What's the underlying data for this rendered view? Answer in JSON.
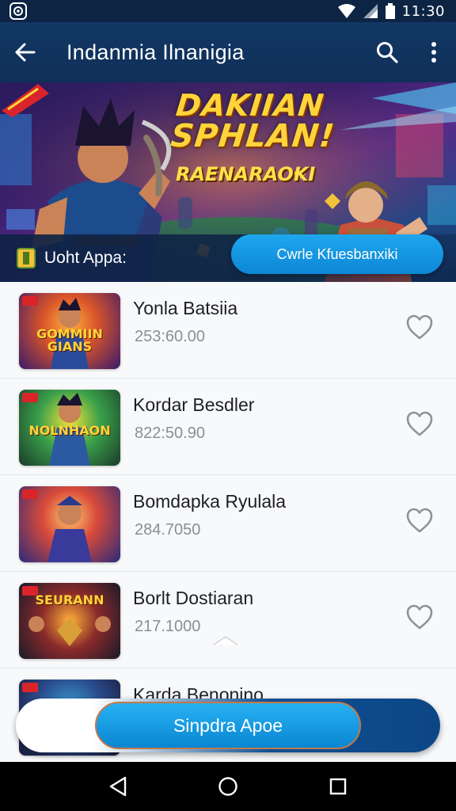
{
  "status_bar": {
    "time": "11:30"
  },
  "app_bar": {
    "title": "Indanmia Ilnanigia"
  },
  "banner": {
    "headline_line1": "DAKIIAN",
    "headline_line2": "SPHLAN!",
    "subtitle": "RAENARAOKI",
    "label": "Uoht Appa:",
    "cta_label": "Cwrle Kfuesbanxiki"
  },
  "items": [
    {
      "title": "Yonla Batsiia",
      "subtitle": "253:60.00",
      "thumb_text": "GOMMIIN GIANS"
    },
    {
      "title": "Kordar Besdler",
      "subtitle": "822:50.90",
      "thumb_text": "NOLNHAON"
    },
    {
      "title": "Bomdapka Ryulala",
      "subtitle": "284.7050",
      "thumb_text": ""
    },
    {
      "title": "Borlt Dostiaran",
      "subtitle": "217.1000",
      "thumb_text": "SEURANN"
    },
    {
      "title": "Karda Benonino",
      "subtitle": "",
      "thumb_text": ""
    }
  ],
  "bottom_cta": {
    "label": "Sinpdra Apoe"
  },
  "colors": {
    "app_bar": "#123865",
    "accent": "#1ea7ee",
    "title_yellow": "#ffd43a"
  },
  "icons": {
    "back": "arrow-left-icon",
    "search": "search-icon",
    "more": "more-vert-icon",
    "favorite": "heart-outline-icon"
  }
}
